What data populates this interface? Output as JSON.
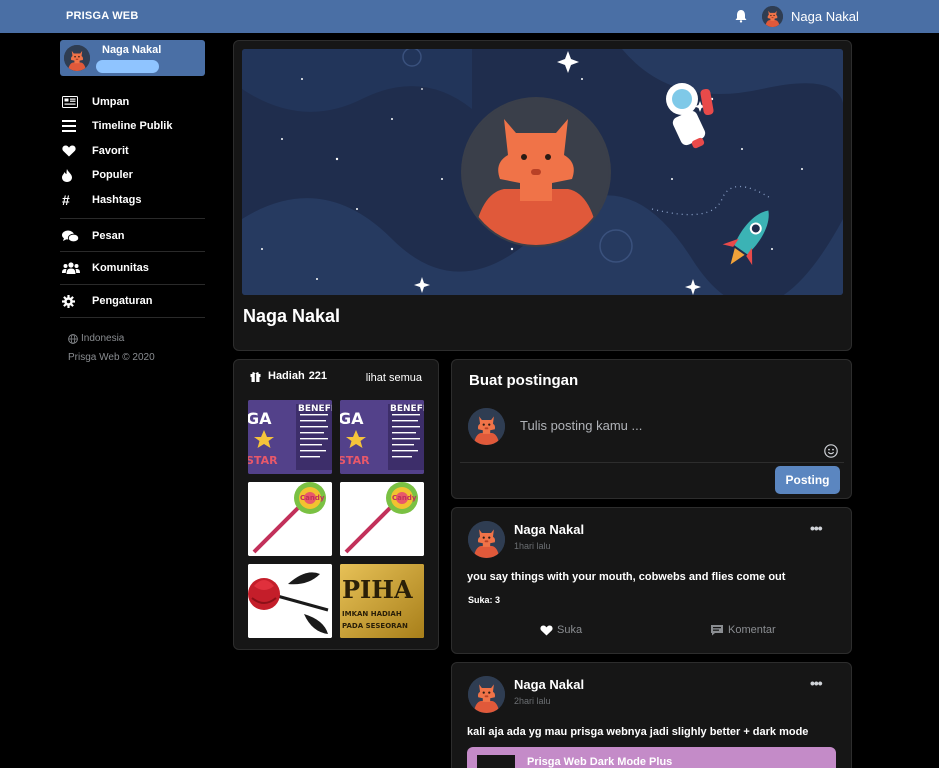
{
  "topbar": {
    "brand": "PRISGA WEB",
    "user_name": "Naga Nakal",
    "bell_icon": "bell-icon"
  },
  "sidebar": {
    "profile_name": "Naga Nakal",
    "items": [
      {
        "label": "Umpan",
        "icon": "newspaper-icon"
      },
      {
        "label": "Timeline Publik",
        "icon": "list-icon"
      },
      {
        "label": "Favorit",
        "icon": "heart-icon"
      },
      {
        "label": "Populer",
        "icon": "fire-icon"
      },
      {
        "label": "Hashtags",
        "icon": "hashtag-icon"
      },
      {
        "label": "Pesan",
        "icon": "chat-icon"
      },
      {
        "label": "Komunitas",
        "icon": "users-icon"
      },
      {
        "label": "Pengaturan",
        "icon": "gear-icon"
      }
    ],
    "language": "Indonesia",
    "copyright": "Prisga Web © 2020"
  },
  "profile": {
    "name": "Naga Nakal"
  },
  "gifts": {
    "title": "Hadiah",
    "count": "221",
    "see_all": "lihat semua",
    "items": [
      {
        "kind": "star-badge",
        "caption": "GA STAR"
      },
      {
        "kind": "star-badge",
        "caption": "GA STAR"
      },
      {
        "kind": "lollipop",
        "caption": "Candy"
      },
      {
        "kind": "lollipop",
        "caption": "Candy"
      },
      {
        "kind": "rose",
        "caption": ""
      },
      {
        "kind": "gold-card",
        "caption": "PIHA"
      }
    ]
  },
  "compose": {
    "title": "Buat postingan",
    "placeholder": "Tulis posting kamu ...",
    "submit": "Posting"
  },
  "posts": [
    {
      "author": "Naga Nakal",
      "time": "1hari lalu",
      "text": "you say things with your mouth, cobwebs and flies come out",
      "likes": "Suka: 3",
      "like_label": "Suka",
      "comment_label": "Komentar"
    },
    {
      "author": "Naga Nakal",
      "time": "2hari lalu",
      "text": "kali aja ada yg mau prisga webnya jadi slighly better + dark mode",
      "link_title": "Prisga Web Dark Mode Plus"
    }
  ],
  "colors": {
    "topbar": "#4a6fa5",
    "accent": "#5b86c0",
    "background": "#000000",
    "card": "#161616",
    "avatar_orange": "#e0593a"
  }
}
